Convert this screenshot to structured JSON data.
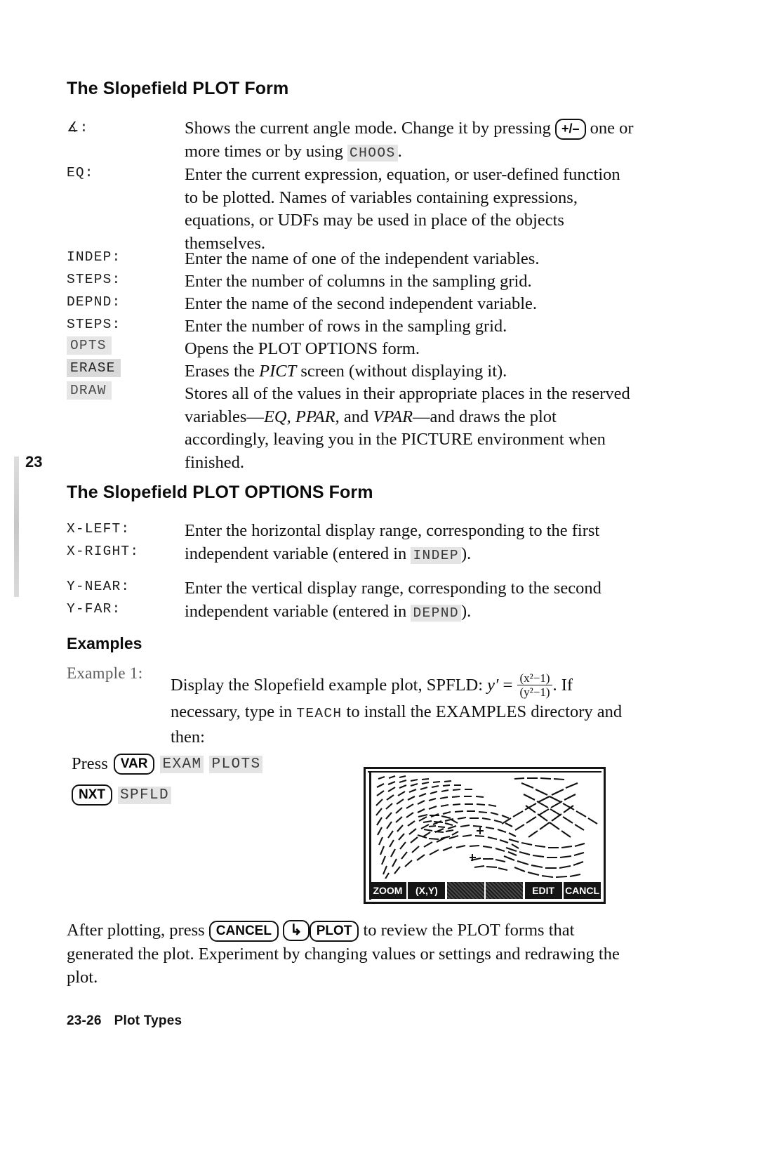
{
  "chapter_marker": "23",
  "sections": {
    "plot_form": {
      "title": "The Slopefield PLOT Form",
      "rows": [
        {
          "term": "∡:",
          "style": "plain",
          "desc_pre": "Shows the current angle mode. Change it by pressing ",
          "key": "+/–",
          "desc_mid": " one or more times or by using ",
          "softkey": "CHOOS",
          "desc_post": "."
        },
        {
          "term": "EQ:",
          "style": "plain",
          "desc": "Enter the current expression, equation, or user-defined function to be plotted. Names of variables containing expressions, equations, or UDFs may be used in place of the objects themselves."
        },
        {
          "term": "INDEP:",
          "style": "plain",
          "desc": "Enter the name of one of the independent variables."
        },
        {
          "term": "STEPS:",
          "style": "plain",
          "desc": "Enter the number of columns in the sampling grid."
        },
        {
          "term": "DEPND:",
          "style": "plain",
          "desc": "Enter the name of the second independent variable."
        },
        {
          "term": "STEPS:",
          "style": "plain",
          "desc": "Enter the number of rows in the sampling grid."
        },
        {
          "term": "OPTS",
          "style": "shaded",
          "desc": "Opens the PLOT OPTIONS form."
        },
        {
          "term": "ERASE",
          "style": "shaded-dark",
          "desc_pre": "Erases the ",
          "ital1": "PICT",
          "desc_post": " screen (without displaying it)."
        },
        {
          "term": "DRAW",
          "style": "shaded",
          "desc_pre": "Stores all of the values in their appropriate places in the reserved variables—",
          "ital1": "EQ",
          "sep1": ", ",
          "ital2": "PPAR",
          "sep2": ", and ",
          "ital3": "VPAR",
          "desc_post": "—and draws the plot accordingly, leaving you in the PICTURE environment when finished."
        }
      ]
    },
    "plot_options_form": {
      "title": "The Slopefield PLOT OPTIONS Form",
      "group1": {
        "terms": [
          "X-LEFT:",
          "X-RIGHT:"
        ],
        "desc_pre": "Enter the horizontal display range, corresponding to the first independent variable (entered in ",
        "softkey": "INDEP",
        "desc_post": ")."
      },
      "group2": {
        "terms": [
          "Y-NEAR:",
          "Y-FAR:"
        ],
        "desc_pre": "Enter the vertical display range, corresponding to the second independent variable (entered in ",
        "softkey": "DEPND",
        "desc_post": ")."
      }
    },
    "examples": {
      "title": "Examples",
      "example1": {
        "label": "Example 1:",
        "line1_pre": "Display the Slopefield example plot, SPFLD: ",
        "formula": {
          "lhs": "y′",
          "eq": "=",
          "numerator": "(x²−1)",
          "denominator": "(y²−1)"
        },
        "line1_post": ".",
        "line2_pre": "If necessary, type in ",
        "line2_mono": "TEACH",
        "line2_post": " to install the EXAMPLES",
        "line3": "directory and then:"
      },
      "press_sequence": {
        "press_label": "Press",
        "keys_line1": [
          {
            "type": "keycap",
            "label": "VAR"
          },
          {
            "type": "softkey",
            "label": "EXAM"
          },
          {
            "type": "softkey",
            "label": "PLOTS"
          }
        ],
        "keys_line2": [
          {
            "type": "keycap",
            "label": "NXT"
          },
          {
            "type": "softkey",
            "label": "SPFLD"
          }
        ]
      },
      "lcd": {
        "menu_keys": [
          "ZOOM",
          "(X,Y)",
          "",
          "",
          "EDIT",
          "CANCL"
        ]
      }
    },
    "closing": {
      "pre": "After plotting, press ",
      "key1": "CANCEL",
      "key2": "↳",
      "key3": "PLOT",
      "post": " to review the PLOT forms that generated the plot. Experiment by changing values or settings and redrawing the plot."
    },
    "footer": {
      "page_number": "23-26",
      "title": "Plot Types"
    }
  }
}
